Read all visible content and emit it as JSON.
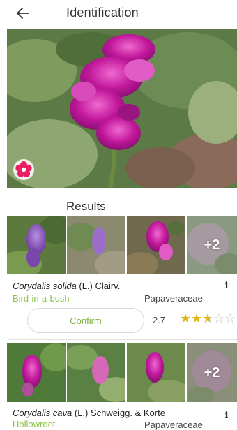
{
  "header": {
    "back_icon": "arrow-left-icon",
    "title": "Identification"
  },
  "main_photo": {
    "badge_icon": "flower-icon",
    "badge_color": "#e91e63"
  },
  "results_title": "Results",
  "results": [
    {
      "genus_species": "Corydalis solida",
      "author": " (L.) Clairv.",
      "common_name": "Bird-in-a-bush",
      "family": "Papaveraceae",
      "more_images": "+2",
      "confirm_label": "Confirm",
      "score": "2.7",
      "rating_out_of_5": 2.7
    },
    {
      "genus_species": "Corydalis cava",
      "author": " (L.) Schweigg. & Körte",
      "common_name": "Hollowroot",
      "family": "Papaveraceae",
      "more_images": "+2"
    }
  ],
  "colors": {
    "accent_green": "#8bc34a",
    "star_gold": "#e3b614",
    "flower_magenta": "#c2189b"
  }
}
